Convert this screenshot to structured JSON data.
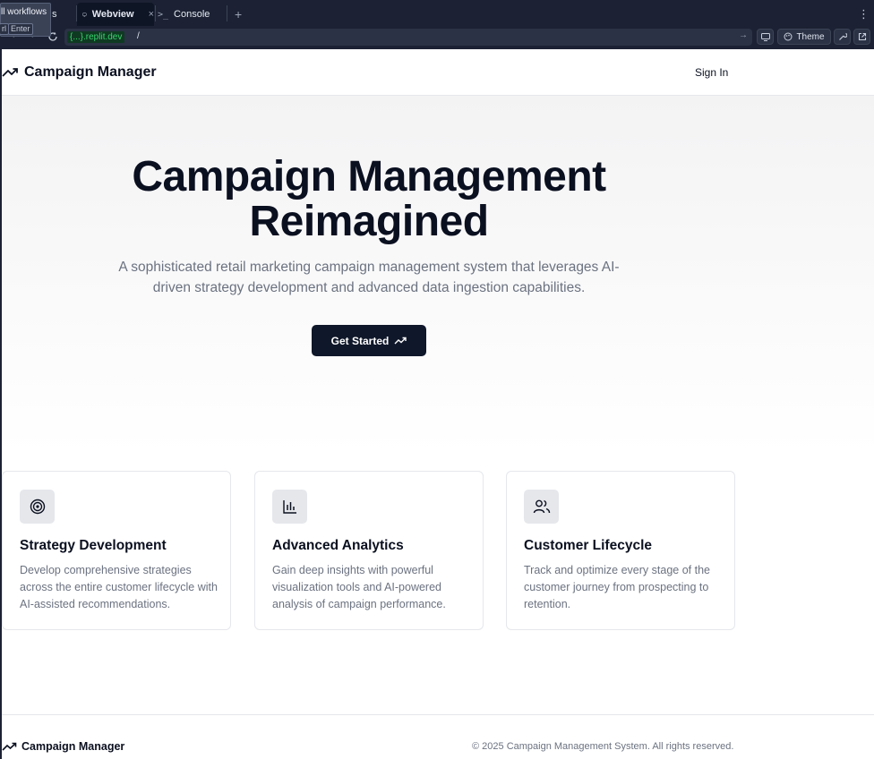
{
  "ide": {
    "tooltip": {
      "text": "ll workflows",
      "key1": "rl",
      "key2": "Enter"
    },
    "tabs": [
      {
        "label": "s"
      },
      {
        "label": "Webview"
      },
      {
        "label": "Console"
      }
    ],
    "url_host": "{...}.replit.dev",
    "url_path": "/",
    "theme_label": "Theme"
  },
  "nav": {
    "brand": "Campaign Manager",
    "signin": "Sign In"
  },
  "hero": {
    "title": "Campaign Management Reimagined",
    "subtitle": "A sophisticated retail marketing campaign management system that leverages AI-driven strategy development and advanced data ingestion capabilities.",
    "cta": "Get Started"
  },
  "features": [
    {
      "icon": "target-icon",
      "title": "Strategy Development",
      "desc": "Develop comprehensive strategies across the entire customer lifecycle with AI-assisted recommendations."
    },
    {
      "icon": "bar-chart-icon",
      "title": "Advanced Analytics",
      "desc": "Gain deep insights with powerful visualization tools and AI-powered analysis of campaign performance."
    },
    {
      "icon": "users-icon",
      "title": "Customer Lifecycle",
      "desc": "Track and optimize every stage of the customer journey from prospecting to retention."
    }
  ],
  "footer": {
    "brand": "Campaign Manager",
    "copyright": "© 2025 Campaign Management System. All rights reserved."
  }
}
